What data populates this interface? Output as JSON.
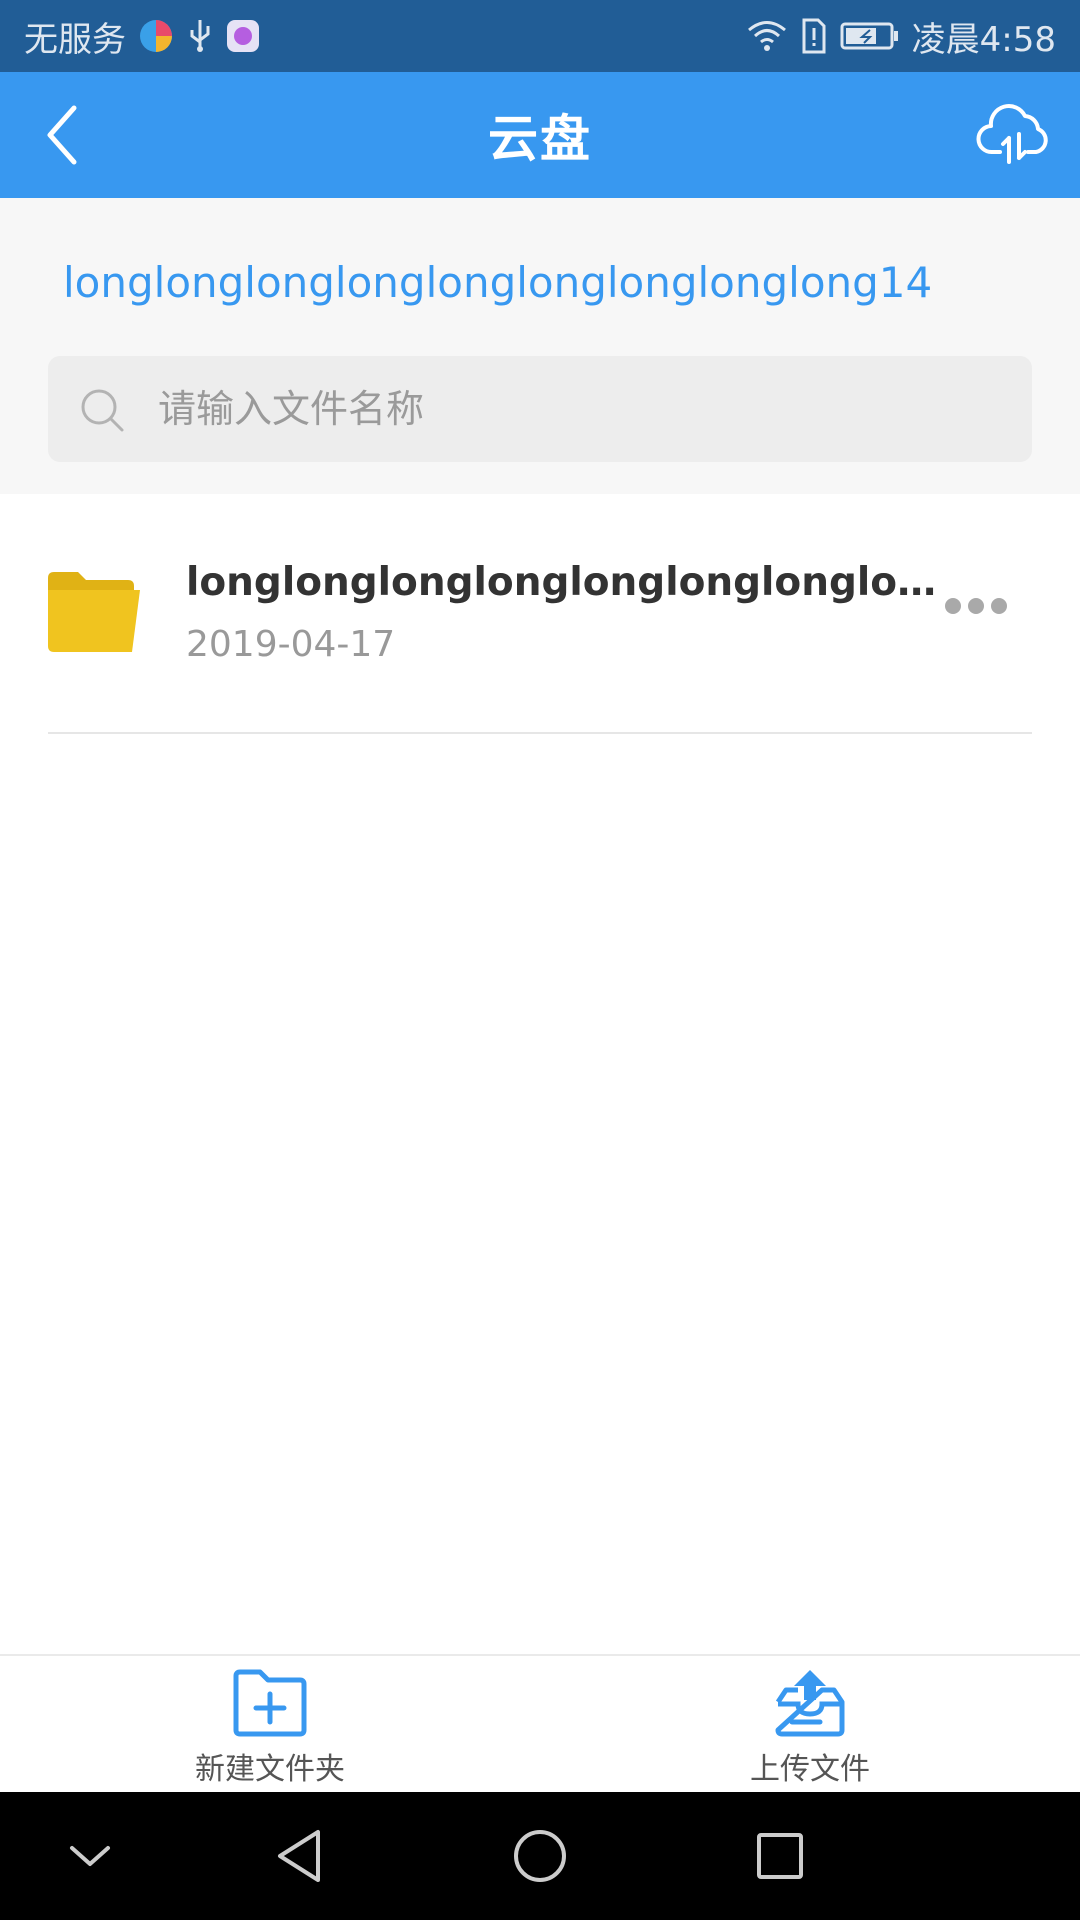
{
  "status_bar": {
    "carrier": "无服务",
    "time": "凌晨4:58",
    "icons": [
      "browser-app-icon",
      "usb-icon",
      "app-icon",
      "wifi-icon",
      "sim-alert-icon",
      "battery-charging-icon"
    ]
  },
  "title_bar": {
    "title": "云盘",
    "back_icon": "chevron-left-icon",
    "action_icon": "cloud-transfer-icon"
  },
  "breadcrumb": "longlonglonglonglonglonglonglonglong14",
  "search": {
    "placeholder": "请输入文件名称",
    "value": ""
  },
  "files": [
    {
      "name": "longlonglonglonglonglonglonglonglong",
      "date": "2019-04-17",
      "icon": "folder-icon"
    }
  ],
  "bottom_actions": {
    "new_folder": "新建文件夹",
    "upload_file": "上传文件"
  },
  "colors": {
    "status_bar": "#215d96",
    "accent": "#3898f0",
    "folder": "#f0c41f"
  }
}
